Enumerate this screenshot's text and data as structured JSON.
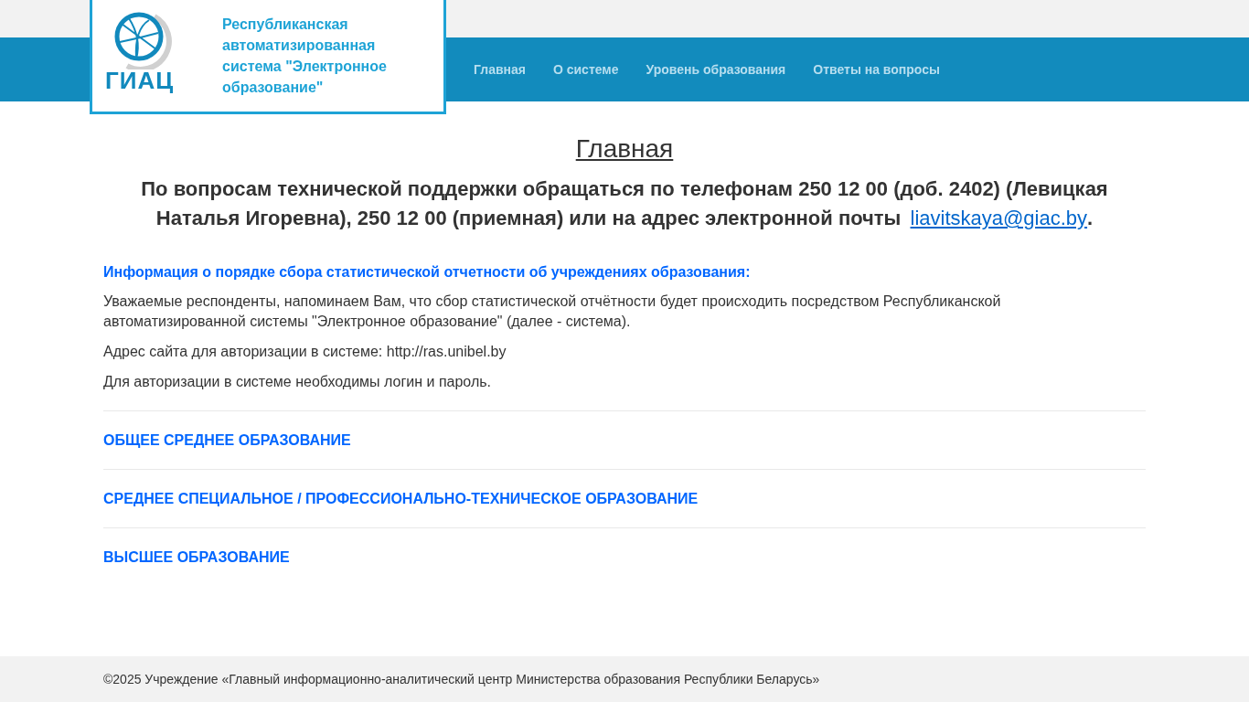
{
  "header": {
    "logo_text": "ГИАЦ",
    "site_title": "Республиканская автоматизированная система \"Электронное образование\""
  },
  "nav": [
    {
      "label": "Главная"
    },
    {
      "label": "О системе"
    },
    {
      "label": "Уровень образования"
    },
    {
      "label": "Ответы на вопросы"
    }
  ],
  "main": {
    "heading": "Главная",
    "support_text": "По вопросам технической поддержки обращаться по телефонам 250 12 00 (доб. 2402) (Левицкая Наталья Игоревна), 250 12 00 (приемная) или на адрес электронной почты ",
    "support_email": "liavitskaya@giac.by",
    "support_end": ".",
    "info_title": "Информация о порядке сбора статистической отчетности об учреждениях образования:",
    "paragraphs": [
      "Уважаемые респонденты, напоминаем Вам, что сбор статистической отчётности будет происходить посредством Республиканской автоматизированной системы \"Электронное образование\" (далее - система).",
      "Адрес сайта для авторизации в системе: http://ras.unibel.by",
      "Для авторизации в системе необходимы логин и пароль."
    ],
    "sections": [
      {
        "label": "ОБЩЕЕ СРЕДНЕЕ ОБРАЗОВАНИЕ"
      },
      {
        "label": "СРЕДНЕЕ СПЕЦИАЛЬНОЕ / ПРОФЕССИОНАЛЬНО-ТЕХНИЧЕСКОЕ ОБРАЗОВАНИЕ"
      },
      {
        "label": "ВЫСШЕЕ ОБРАЗОВАНИЕ"
      }
    ]
  },
  "footer": {
    "text": "©2025 Учреждение «Главный информационно-аналитический центр Министерства образования Республики Беларусь»"
  }
}
